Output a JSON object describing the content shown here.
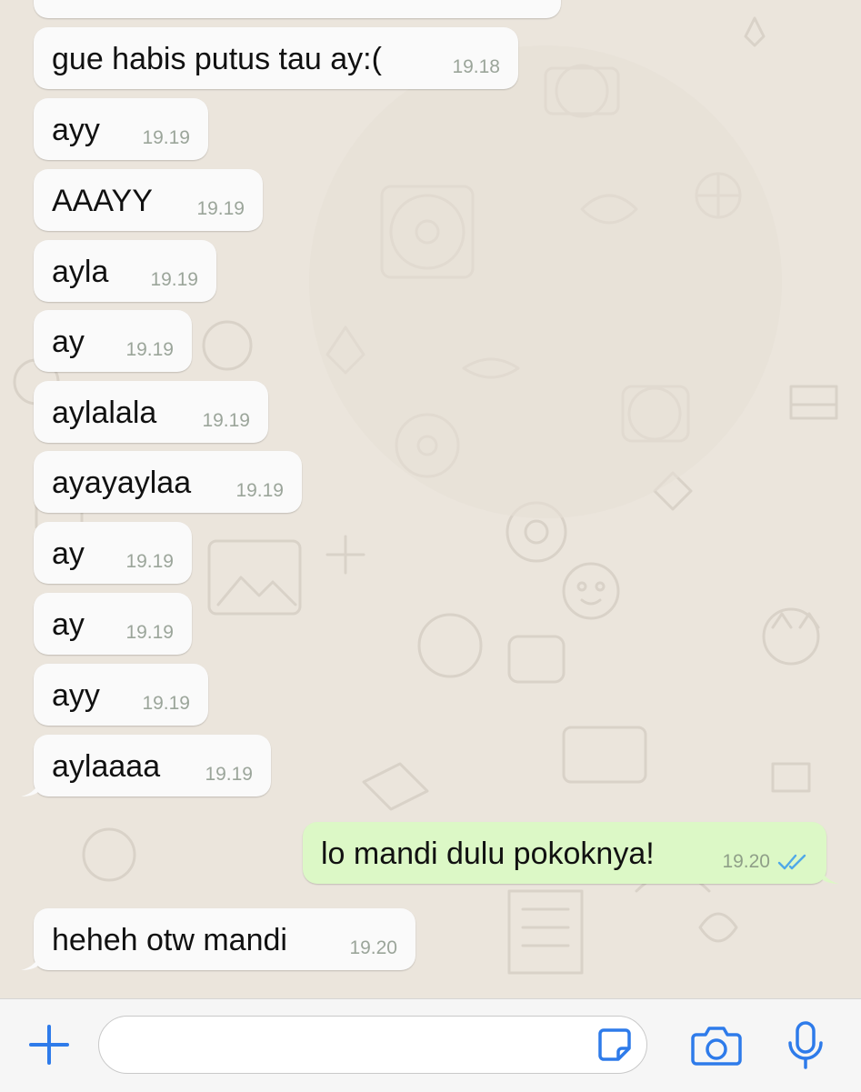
{
  "colors": {
    "chat_background": "#ebe5dc",
    "incoming_bubble": "#fafafa",
    "outgoing_bubble": "#dcf8c6",
    "read_ticks": "#4fa8e8",
    "icon_blue": "#2e7bea"
  },
  "messages": [
    {
      "direction": "incoming",
      "text": "gue habis putus tau ay:(",
      "time": "19.18"
    },
    {
      "direction": "incoming",
      "text": "ayy",
      "time": "19.19"
    },
    {
      "direction": "incoming",
      "text": "AAAYY",
      "time": "19.19"
    },
    {
      "direction": "incoming",
      "text": "ayla",
      "time": "19.19"
    },
    {
      "direction": "incoming",
      "text": "ay",
      "time": "19.19"
    },
    {
      "direction": "incoming",
      "text": "aylalala",
      "time": "19.19"
    },
    {
      "direction": "incoming",
      "text": "ayayaylaa",
      "time": "19.19"
    },
    {
      "direction": "incoming",
      "text": "ay",
      "time": "19.19"
    },
    {
      "direction": "incoming",
      "text": "ay",
      "time": "19.19"
    },
    {
      "direction": "incoming",
      "text": "ayy",
      "time": "19.19"
    },
    {
      "direction": "incoming",
      "text": "aylaaaa",
      "time": "19.19"
    },
    {
      "direction": "outgoing",
      "text": "lo mandi dulu pokoknya!",
      "time": "19.20",
      "status": "read"
    },
    {
      "direction": "incoming",
      "text": "heheh otw mandi",
      "time": "19.20"
    }
  ],
  "input_bar": {
    "message_placeholder": "",
    "icons": [
      "plus-icon",
      "sticker-icon",
      "camera-icon",
      "microphone-icon"
    ]
  }
}
